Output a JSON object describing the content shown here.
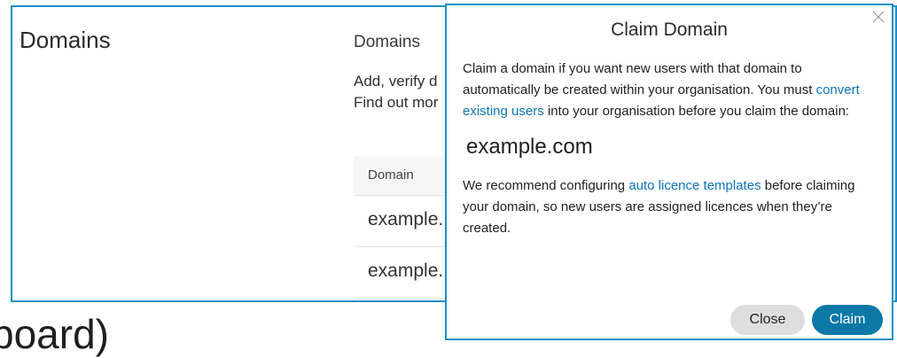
{
  "background": {
    "section_title": "Domains",
    "heading": "Domains",
    "desc_line1": "Add, verify d",
    "desc_line2": "Find out mor",
    "table_header": "Domain",
    "rows": [
      "example.",
      "example."
    ],
    "bottom_text": "board)"
  },
  "modal": {
    "title": "Claim Domain",
    "p1_before": "Claim a domain if you want new users with that domain to automatically be created within your organisation. You must ",
    "p1_link": "convert existing users",
    "p1_after": " into your organisation before you claim the domain:",
    "domain": "example.com",
    "p2_before": "We recommend configuring ",
    "p2_link": "auto licence templates",
    "p2_after": " before claiming your domain, so new users are assigned licences when they’re created.",
    "close_label": "Close",
    "claim_label": "Claim"
  },
  "colors": {
    "accent": "#1a8fc7",
    "link": "#0d75b8",
    "primary_button": "#0b78a8",
    "secondary_button": "#dedede"
  },
  "icons": {
    "close": "close-icon"
  }
}
